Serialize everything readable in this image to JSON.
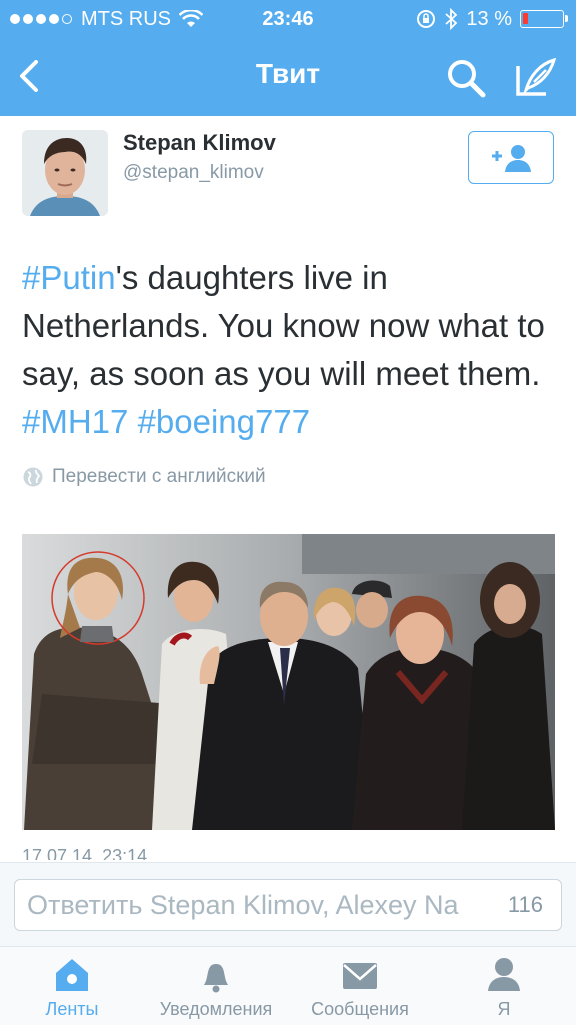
{
  "status_bar": {
    "carrier": "MTS RUS",
    "time": "23:46",
    "battery": "13 %",
    "battery_level": 0.13
  },
  "nav": {
    "title": "Твит",
    "back_icon": "chevron-left-icon",
    "search_icon": "search-icon",
    "compose_icon": "compose-icon"
  },
  "tweet": {
    "author_name": "Stepan Klimov",
    "author_handle": "@stepan_klimov",
    "text_parts": [
      {
        "text": "#Putin",
        "tag": true
      },
      {
        "text": "'s daughters live in Netherlands. You know now what to say, as soon as you will meet them. ",
        "tag": false
      },
      {
        "text": "#MH17",
        "tag": true
      },
      {
        "text": " ",
        "tag": false
      },
      {
        "text": "#boeing777",
        "tag": true
      }
    ],
    "translate_label": "Перевести с английский",
    "timestamp": "17.07.14, 23:14"
  },
  "reply": {
    "placeholder": "Ответить Stepan Klimov, Alexey Na",
    "counter": "116"
  },
  "tabs": [
    {
      "label": "Ленты",
      "icon": "home-icon",
      "active": true
    },
    {
      "label": "Уведомления",
      "icon": "bell-icon",
      "active": false
    },
    {
      "label": "Сообщения",
      "icon": "envelope-icon",
      "active": false
    },
    {
      "label": "Я",
      "icon": "person-icon",
      "active": false
    }
  ],
  "colors": {
    "accent": "#55acee",
    "text": "#292f33",
    "secondary": "#8899a6"
  }
}
